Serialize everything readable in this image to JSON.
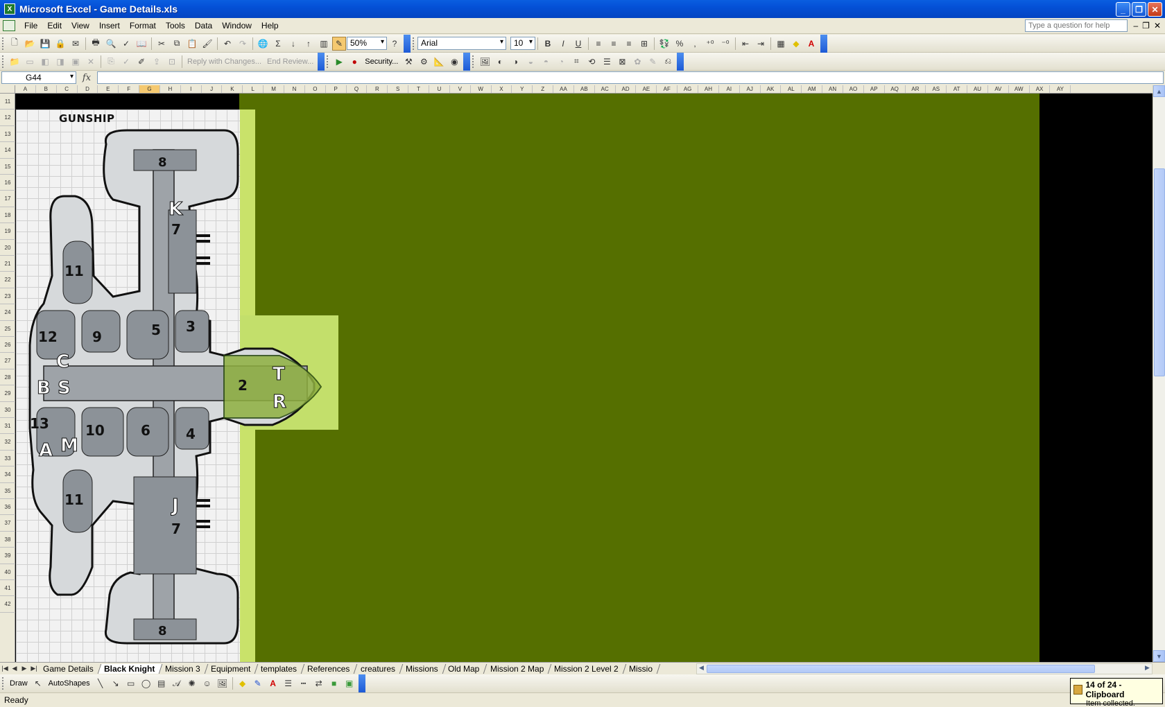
{
  "window": {
    "title": "Microsoft Excel - Game Details.xls",
    "app_icon_glyph": "X"
  },
  "menu": [
    "File",
    "Edit",
    "View",
    "Insert",
    "Format",
    "Tools",
    "Data",
    "Window",
    "Help"
  ],
  "help_box": {
    "placeholder": "Type a question for help"
  },
  "toolbar": {
    "zoom": "50%",
    "font_name": "Arial",
    "font_size": "10",
    "bold": "B",
    "italic": "I",
    "underline": "U",
    "percent": "%",
    "comma": ",",
    "review_reply": "Reply with Changes...",
    "review_end": "End Review...",
    "security": "Security..."
  },
  "formula_bar": {
    "name_box": "G44",
    "fx": "fx",
    "formula": ""
  },
  "columns": [
    "A",
    "B",
    "C",
    "D",
    "E",
    "F",
    "G",
    "H",
    "I",
    "J",
    "K",
    "L",
    "M",
    "N",
    "O",
    "P",
    "Q",
    "R",
    "S",
    "T",
    "U",
    "V",
    "W",
    "X",
    "Y",
    "Z",
    "AA",
    "AB",
    "AC",
    "AD",
    "AE",
    "AF",
    "AG",
    "AH",
    "AI",
    "AJ",
    "AK",
    "AL",
    "AM",
    "AN",
    "AO",
    "AP",
    "AQ",
    "AR",
    "AS",
    "AT",
    "AU",
    "AV",
    "AW",
    "AX",
    "AY"
  ],
  "selected_column": "G",
  "rows": [
    "11",
    "12",
    "13",
    "14",
    "15",
    "16",
    "17",
    "18",
    "19",
    "20",
    "21",
    "22",
    "23",
    "24",
    "25",
    "26",
    "27",
    "28",
    "29",
    "30",
    "31",
    "32",
    "33",
    "34",
    "35",
    "36",
    "37",
    "38",
    "39",
    "40",
    "41",
    "42"
  ],
  "map": {
    "title": "GUNSHIP",
    "room_labels": [
      "8",
      "K",
      "7",
      "11",
      "12",
      "9",
      "5",
      "3",
      "2",
      "T",
      "R",
      "C",
      "B",
      "S",
      "13",
      "10",
      "6",
      "4",
      "A",
      "M",
      "11",
      "J",
      "7",
      "8"
    ]
  },
  "sheet_tabs": [
    "Game Details",
    "Black Knight",
    "Mission 3",
    "Equipment",
    "templates",
    "References",
    "creatures",
    "Missions",
    "Old Map",
    "Mission 2 Map",
    "Mission 2 Level 2",
    "Missio"
  ],
  "active_tab": "Black Knight",
  "draw_toolbar": {
    "draw": "Draw",
    "autoshapes": "AutoShapes"
  },
  "status": {
    "text": "Ready"
  },
  "clipboard": {
    "title": "14 of 24 - Clipboard",
    "message": "Item collected."
  },
  "colors": {
    "olive_fill": "#556f00",
    "light_green": "#c9e26a",
    "title_blue": "#0450d6"
  }
}
